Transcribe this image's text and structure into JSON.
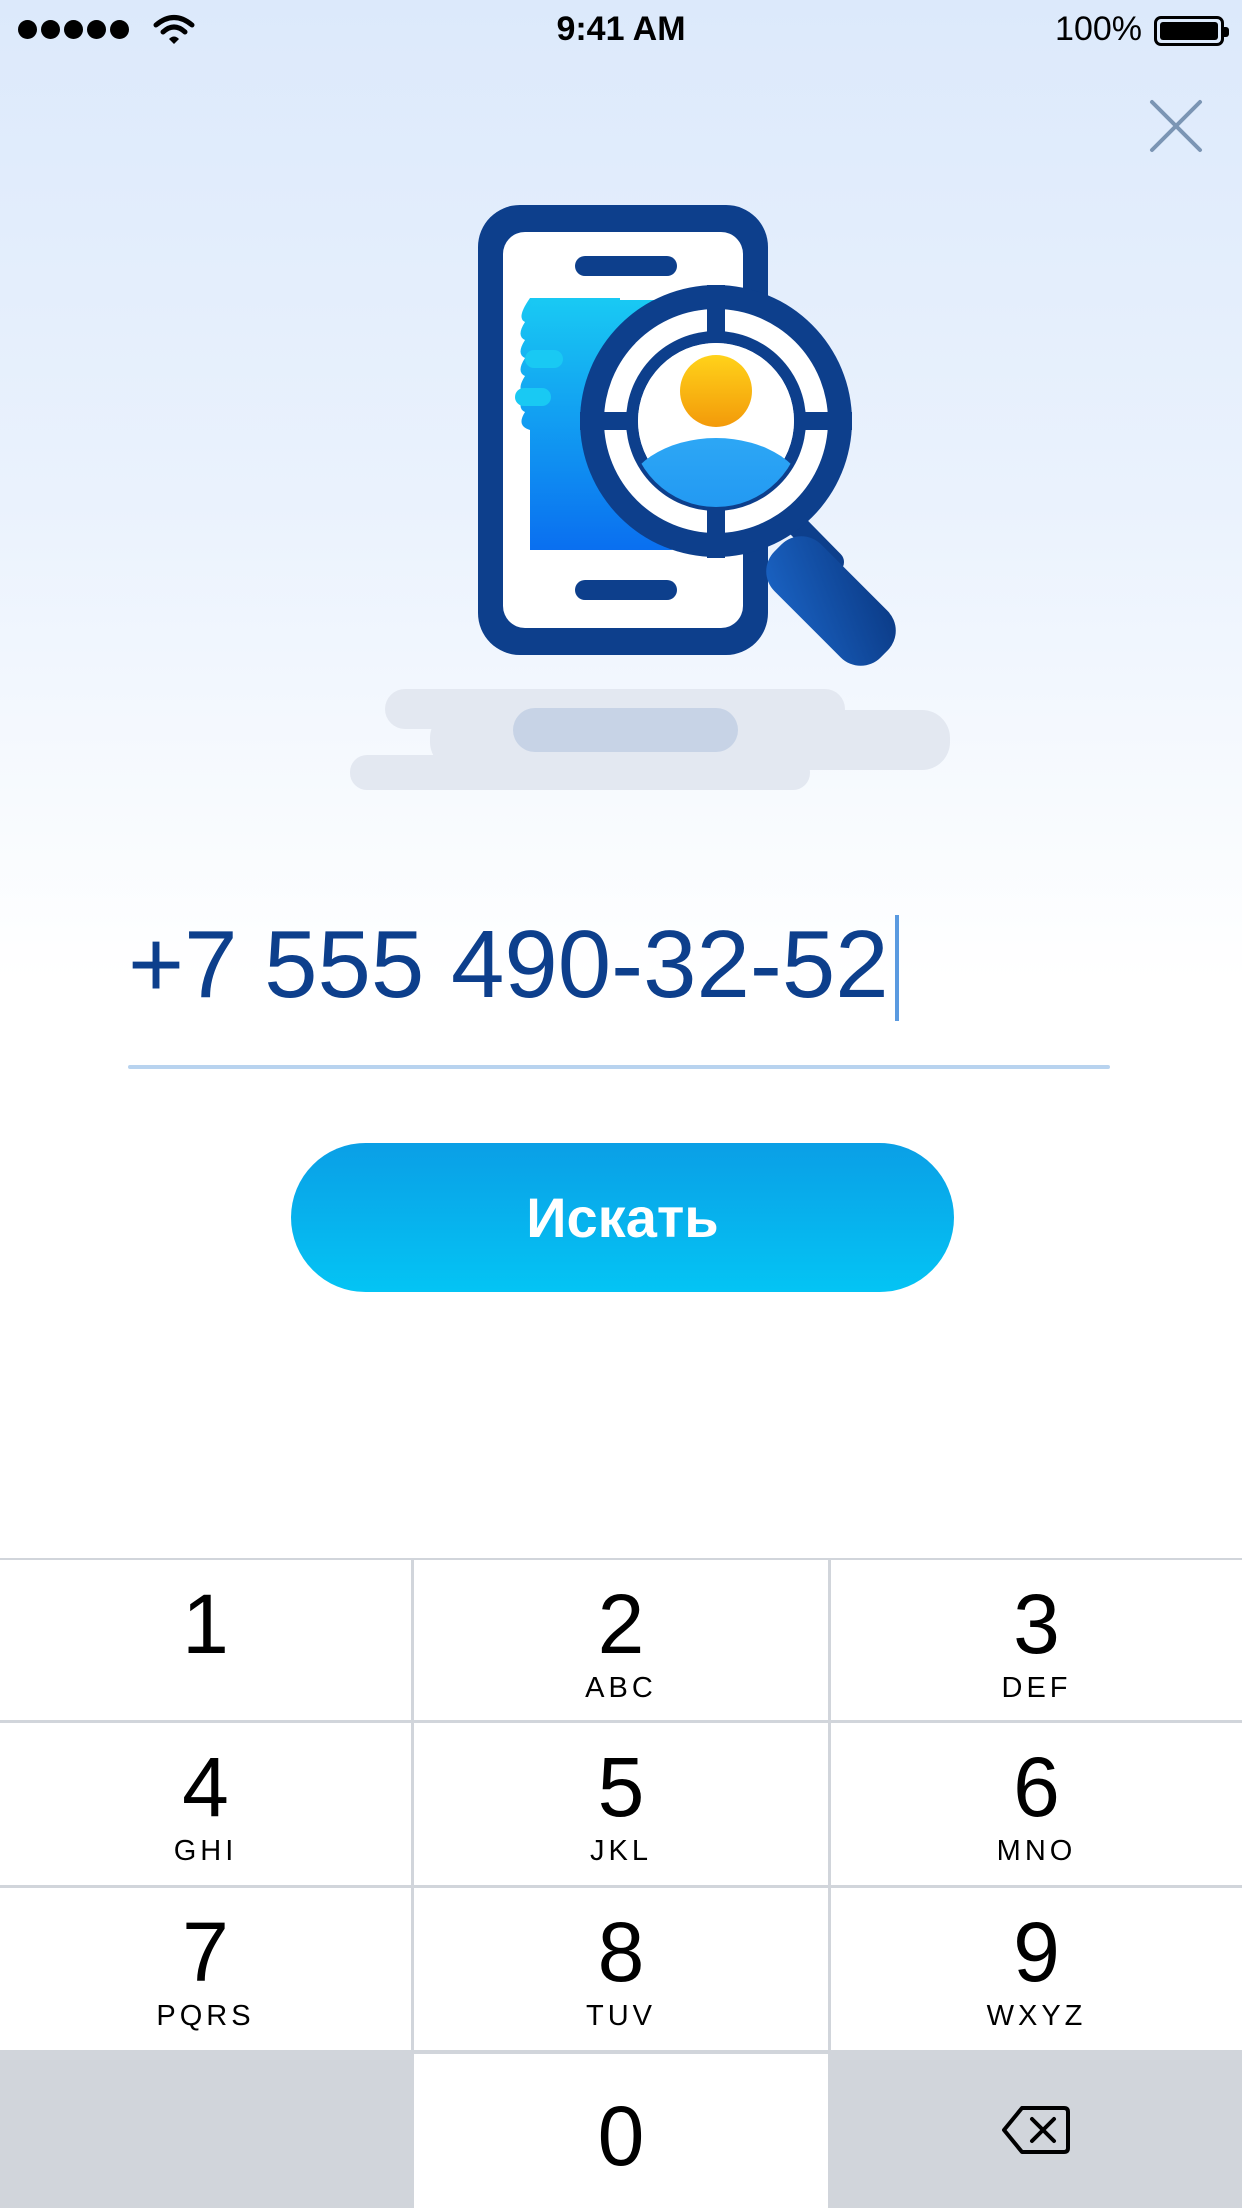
{
  "status_bar": {
    "time": "9:41 AM",
    "battery_percent": "100%",
    "signal_icon": "signal-dots-icon",
    "wifi_icon": "wifi-icon",
    "battery_icon": "battery-icon"
  },
  "header": {
    "close_icon": "close-icon"
  },
  "illustration": {
    "icon": "phone-search-icon",
    "colors": {
      "navy": "#0d3f8c",
      "cyan": "#16c8f4",
      "blue": "#0a73f0",
      "orange": "#f5a40a"
    }
  },
  "search": {
    "phone_value": "+7 555 490-32-52",
    "button_label": "Искать",
    "accent_color": "#06aef0"
  },
  "keypad": {
    "keys": [
      {
        "digit": "1",
        "letters": ""
      },
      {
        "digit": "2",
        "letters": "ABC"
      },
      {
        "digit": "3",
        "letters": "DEF"
      },
      {
        "digit": "4",
        "letters": "GHI"
      },
      {
        "digit": "5",
        "letters": "JKL"
      },
      {
        "digit": "6",
        "letters": "MNO"
      },
      {
        "digit": "7",
        "letters": "PQRS"
      },
      {
        "digit": "8",
        "letters": "TUV"
      },
      {
        "digit": "9",
        "letters": "WXYZ"
      },
      {
        "digit": "0",
        "letters": ""
      }
    ],
    "delete_icon": "backspace-icon"
  }
}
